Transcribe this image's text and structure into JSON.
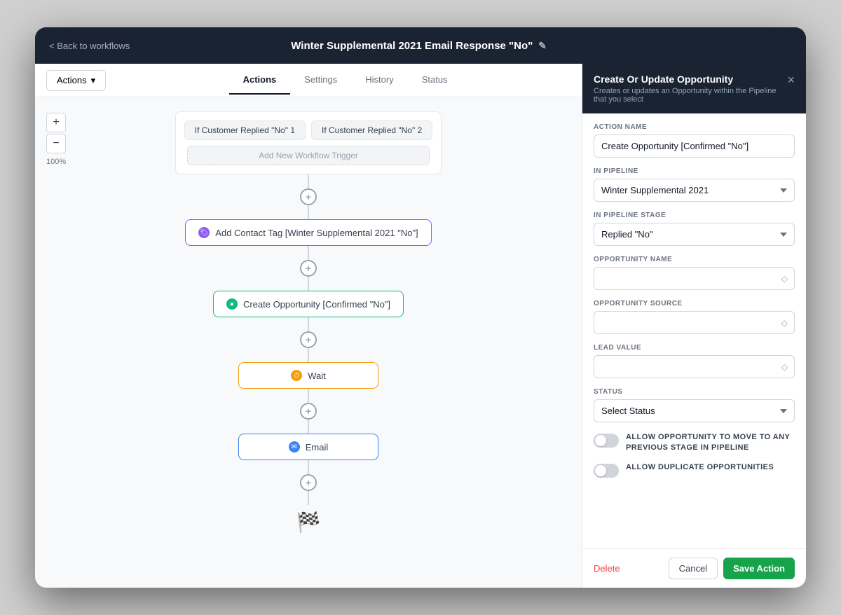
{
  "topBar": {
    "backLabel": "< Back to workflows",
    "title": "Winter Supplemental 2021 Email Response \"No\"",
    "editIcon": "✎"
  },
  "tabs": {
    "actions": "Actions",
    "settings": "Settings",
    "history": "History",
    "status": "Status",
    "activeTab": "Actions"
  },
  "actionsButton": "Actions",
  "zoom": {
    "plus": "+",
    "minus": "−",
    "percent": "100%"
  },
  "canvas": {
    "trigger1": "If Customer Replied \"No\" 1",
    "trigger2": "If Customer Replied \"No\" 2",
    "addTrigger": "Add New Workflow Trigger",
    "node1": "Add Contact Tag [Winter Supplemental 2021 \"No\"]",
    "node2": "Create Opportunity [Confirmed \"No\"]",
    "node3": "Wait",
    "node4": "Email"
  },
  "panel": {
    "title": "Create Or Update Opportunity",
    "subtitle": "Creates or updates an Opportunity within the Pipeline that you select",
    "closeIcon": "×",
    "fields": {
      "actionNameLabel": "ACTION NAME",
      "actionNameValue": "Create Opportunity [Confirmed \"No\"]",
      "inPipelineLabel": "IN PIPELINE",
      "inPipelineValue": "Winter Supplemental 2021",
      "inPipelineStageLabel": "IN PIPELINE STAGE",
      "inPipelineStageValue": "Replied \"No\"",
      "opportunityNameLabel": "OPPORTUNITY NAME",
      "opportunityNamePlaceholder": "",
      "opportunitySourceLabel": "OPPORTUNITY SOURCE",
      "opportunitySourcePlaceholder": "",
      "leadValueLabel": "LEAD VALUE",
      "leadValuePlaceholder": "",
      "statusLabel": "STATUS",
      "statusPlaceholder": "Select Status",
      "toggleLabel1": "ALLOW OPPORTUNITY TO MOVE TO ANY PREVIOUS STAGE IN PIPELINE",
      "toggleLabel2": "ALLOW DUPLICATE OPPORTUNITIES"
    },
    "footer": {
      "deleteLabel": "Delete",
      "cancelLabel": "Cancel",
      "saveLabel": "Save Action"
    }
  }
}
